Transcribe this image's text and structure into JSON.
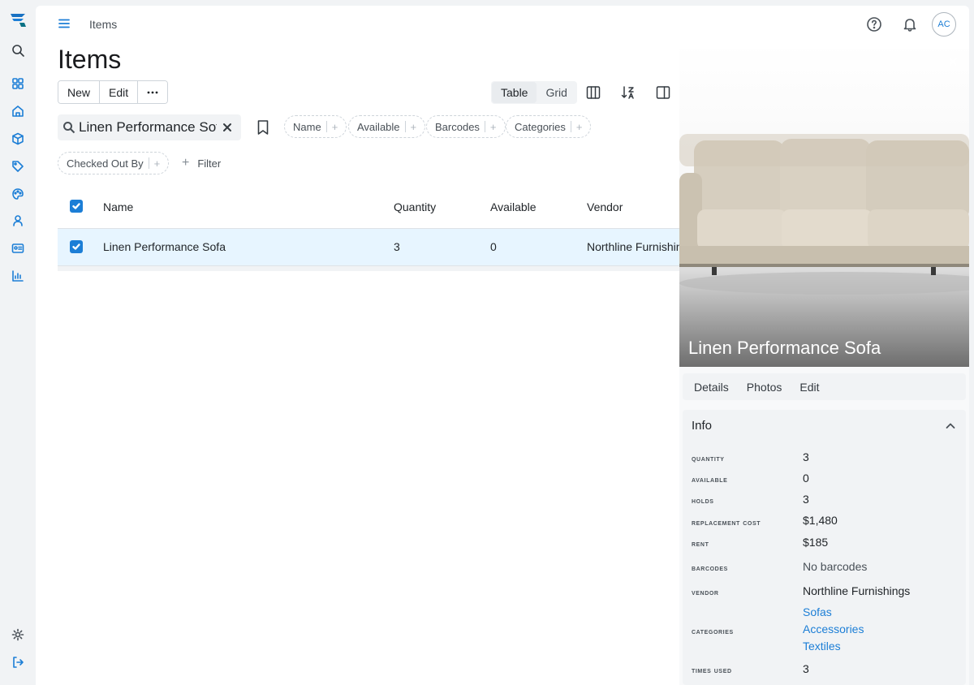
{
  "header": {
    "breadcrumb": "Items",
    "avatar_initials": "AC"
  },
  "page": {
    "title": "Items"
  },
  "toolbar": {
    "new_label": "New",
    "edit_label": "Edit",
    "view_modes": [
      "Table",
      "Grid"
    ],
    "active_view": "Table"
  },
  "search": {
    "value": "Linen Performance Sofa"
  },
  "filter_chips": {
    "name": "Name",
    "available": "Available",
    "barcodes": "Barcodes",
    "categories": "Categories",
    "checked_out_by": "Checked Out By",
    "plus": "+"
  },
  "filter_button": "Filter",
  "table": {
    "columns": [
      "Name",
      "Quantity",
      "Available",
      "Vendor"
    ],
    "rows": [
      {
        "name": "Linen Performance Sofa",
        "quantity": "3",
        "available": "0",
        "vendor": "Northline Furnishings"
      }
    ]
  },
  "detail": {
    "title": "Linen Performance Sofa",
    "tabs": [
      "Details",
      "Photos",
      "Edit"
    ],
    "section": "Info",
    "fields": {
      "quantity": {
        "label": "Quantity",
        "value": "3"
      },
      "available": {
        "label": "Available",
        "value": "0"
      },
      "holds": {
        "label": "Holds",
        "value": "3"
      },
      "replacement_cost": {
        "label": "Replacement cost",
        "value": "$1,480"
      },
      "rent": {
        "label": "Rent",
        "value": "$185"
      },
      "barcodes": {
        "label": "Barcodes",
        "value": "No barcodes"
      },
      "vendor": {
        "label": "Vendor",
        "value": "Northline Furnishings"
      },
      "categories": {
        "label": "Categories",
        "values": [
          "Sofas",
          "Accessories",
          "Textiles"
        ]
      },
      "times_used": {
        "label": "Times used",
        "value": "3"
      }
    }
  },
  "colors": {
    "accent": "#1c7ed6",
    "selected_row": "#e7f5ff",
    "panel_bg": "#f1f3f5"
  },
  "icons": [
    "app-logo-icon",
    "search-icon",
    "dashboard-icon",
    "home-icon",
    "box-icon",
    "tag-icon",
    "palette-icon",
    "user-icon",
    "id-card-icon",
    "chart-icon",
    "gear-icon",
    "logout-icon",
    "menu-icon",
    "help-icon",
    "bell-icon",
    "columns-icon",
    "sort-icon",
    "side-panel-icon",
    "bookmark-icon",
    "close-icon",
    "chevron-up-icon"
  ]
}
